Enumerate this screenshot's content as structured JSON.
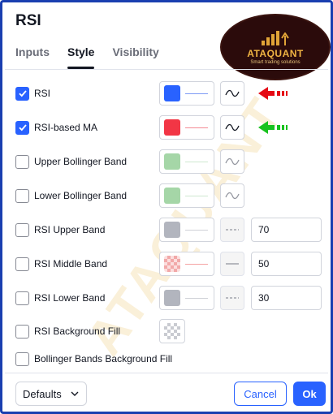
{
  "dialog": {
    "title": "RSI",
    "tabs": [
      {
        "label": "Inputs",
        "active": false
      },
      {
        "label": "Style",
        "active": true
      },
      {
        "label": "Visibility",
        "active": false
      }
    ]
  },
  "logo": {
    "name": "ATAQUANT",
    "tagline": "Smart trading solutions",
    "watermark": "ATAQUANT"
  },
  "rows": [
    {
      "label": "RSI",
      "checked": true,
      "color": "#2962ff",
      "line_color": "#7f9cf5",
      "linestyle_icon": "wave-icon",
      "annotation": "red-arrow-icon",
      "annotation_color": "#e50914"
    },
    {
      "label": "RSI-based MA",
      "checked": true,
      "color": "#f23645",
      "line_color": "#f58a93",
      "linestyle_icon": "wave-icon",
      "annotation": "green-arrow-icon",
      "annotation_color": "#17c21d"
    },
    {
      "label": "Upper Bollinger Band",
      "checked": false,
      "color": "#a5d6a7",
      "line_color": "#cfe8d0",
      "linestyle_icon": "wave-icon"
    },
    {
      "label": "Lower Bollinger Band",
      "checked": false,
      "color": "#a5d6a7",
      "line_color": "#cfe8d0",
      "linestyle_icon": "wave-icon"
    },
    {
      "label": "RSI Upper Band",
      "checked": false,
      "color": "#b2b5be",
      "line_color": "#cfd1d7",
      "linestyle_icon": "dashed-line-icon",
      "value": "70"
    },
    {
      "label": "RSI Middle Band",
      "checked": false,
      "color": "#f8bcbc",
      "line_color": "#f5a3a3",
      "linestyle_icon": "solid-line-icon",
      "value": "50"
    },
    {
      "label": "RSI Lower Band",
      "checked": false,
      "color": "#b2b5be",
      "line_color": "#cfd1d7",
      "linestyle_icon": "dashed-line-icon",
      "value": "30"
    },
    {
      "label": "RSI Background Fill",
      "checked": false,
      "fill_icon": "checker-swatch-icon"
    },
    {
      "label": "Bollinger Bands Background Fill",
      "checked": false
    }
  ],
  "footer": {
    "defaults_label": "Defaults",
    "cancel_label": "Cancel",
    "ok_label": "Ok"
  },
  "colors": {
    "accent": "#2962ff",
    "frame": "#1a3fb0"
  }
}
